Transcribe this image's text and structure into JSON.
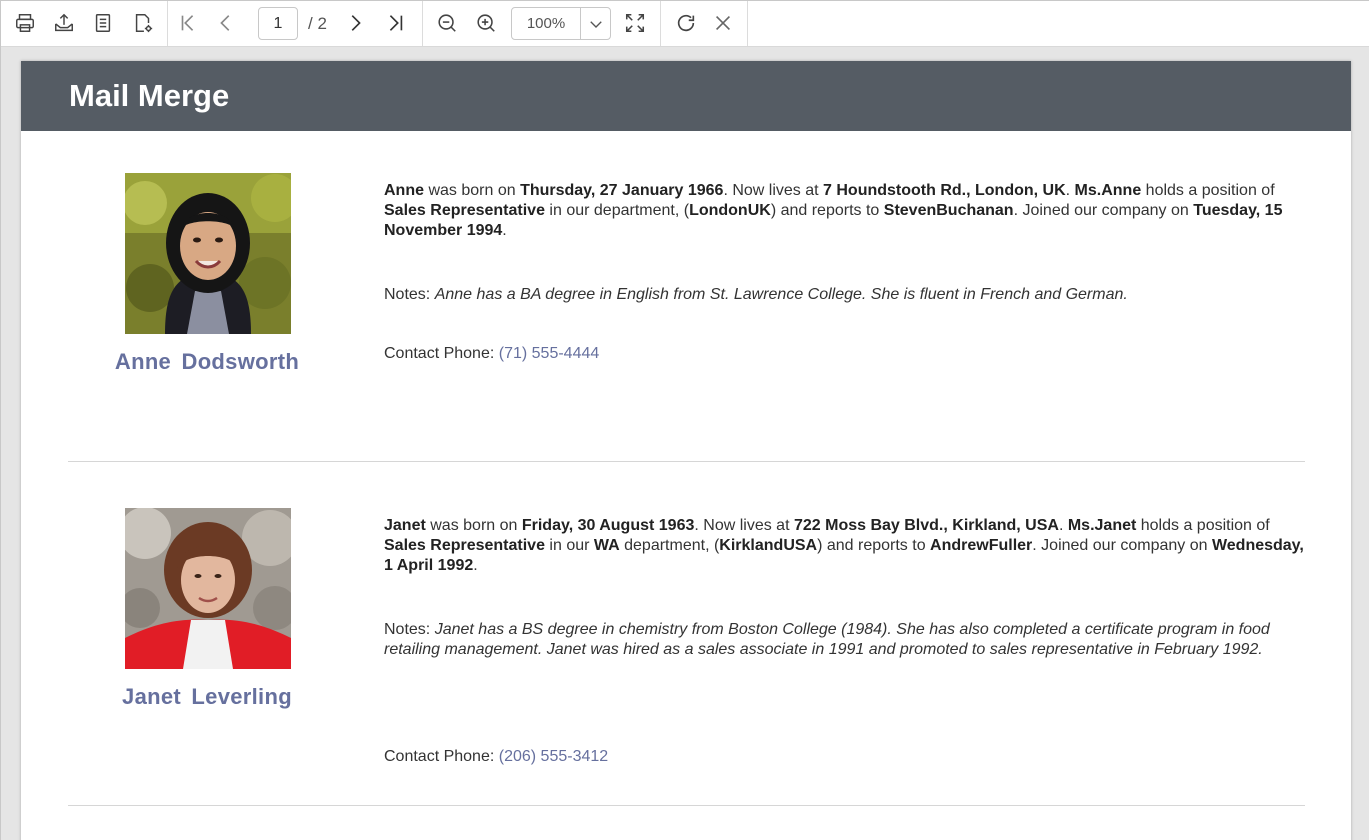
{
  "toolbar": {
    "icons": [
      "print-icon",
      "export-icon",
      "document-icon",
      "page-setup-icon",
      "first-page-icon",
      "previous-page-icon",
      "next-page-icon",
      "last-page-icon",
      "zoom-out-icon",
      "zoom-in-icon",
      "chevron-down-icon",
      "fit-page-icon",
      "refresh-icon",
      "close-icon"
    ],
    "current_page": "1",
    "total_pages": "/ 2",
    "zoom": "100%"
  },
  "report": {
    "title": "Mail Merge",
    "employees": [
      {
        "first_name": "Anne",
        "name": "Anne  Dodsworth",
        "born_prefix": " was born on ",
        "birth_date": "Thursday, 27 January 1966",
        "lives_prefix": ". Now lives at ",
        "address": "7 Houndstooth Rd., London, UK",
        "title_of_courtesy": "Ms.Anne",
        "position_prefix": " holds a position of ",
        "position": "Sales Representative",
        "dept_prefix": " in our ",
        "region": "",
        "dept_mid": " department, (",
        "city_country": "LondonUK",
        "reports_prefix": ") and reports to ",
        "manager": "StevenBuchanan",
        "joined_prefix": ". Joined our company on ",
        "hire_date": "Tuesday, 15 November 1994",
        "period": ".",
        "notes_label": "Notes:",
        "notes": "Anne has a BA degree in English from St. Lawrence College.  She is fluent in French and German.",
        "phone_label": "Contact Phone: ",
        "phone": "(71) 555-4444"
      },
      {
        "first_name": "Janet",
        "name": "Janet  Leverling",
        "born_prefix": " was born on ",
        "birth_date": "Friday, 30 August 1963",
        "lives_prefix": ". Now lives at ",
        "address": "722 Moss Bay Blvd., Kirkland, USA",
        "title_of_courtesy": "Ms.Janet",
        "position_prefix": " holds a position of ",
        "position": "Sales Representative",
        "dept_prefix": " in our ",
        "region": "WA",
        "dept_mid": " department, (",
        "city_country": "KirklandUSA",
        "reports_prefix": ") and reports to ",
        "manager": "AndrewFuller",
        "joined_prefix": ". Joined our company on ",
        "hire_date": "Wednesday, 1 April 1992",
        "period": ".",
        "notes_label": "Notes:",
        "notes": "Janet has a BS degree in chemistry from Boston College (1984).  She has also completed a certificate program in food retailing management.  Janet was hired as a sales associate in 1991 and promoted to sales representative in February 1992.",
        "phone_label": "Contact Phone: ",
        "phone": "(206) 555-3412"
      }
    ]
  },
  "colors": {
    "header_bg": "#555c64",
    "name_accent": "#66709e",
    "icon": "#444444"
  }
}
